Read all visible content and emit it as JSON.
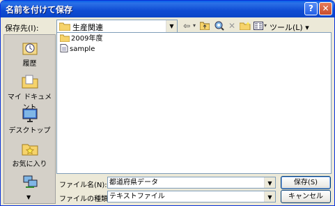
{
  "window": {
    "title": "名前を付けて保存"
  },
  "titlebar": {
    "help_label": "?",
    "close_label": "✕"
  },
  "save_in": {
    "label": "保存先(I):",
    "value": "生産関連"
  },
  "toolbar": {
    "tools_label": "ツール(L) ▾"
  },
  "places": [
    {
      "label": "履歴"
    },
    {
      "label": "マイ ドキュメント"
    },
    {
      "label": "デスクトップ"
    },
    {
      "label": "お気に入り"
    },
    {
      "label": ""
    }
  ],
  "files": [
    {
      "name": "2009年度",
      "type": "folder"
    },
    {
      "name": "sample",
      "type": "file"
    }
  ],
  "filename": {
    "label": "ファイル名(N):",
    "value": "都道府県データ"
  },
  "filetype": {
    "label": "ファイルの種類(T):",
    "value": "テキストファイル"
  },
  "buttons": {
    "save": "保存(S)",
    "cancel": "キャンセル"
  },
  "colors": {
    "titlebar": "#0A5FE8",
    "window_bg": "#ECE9D8",
    "close": "#C94D2D"
  }
}
